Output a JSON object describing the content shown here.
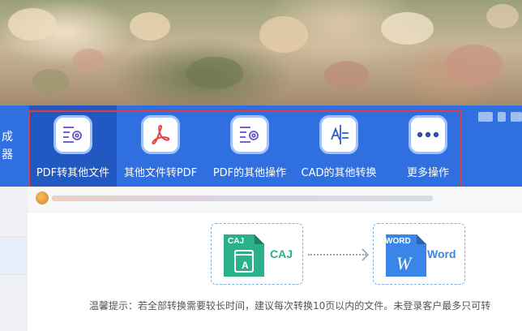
{
  "sidebar_edge": {
    "text": "成器"
  },
  "toolbar": {
    "items": [
      {
        "label": "PDF转其他文件",
        "icon": "gear-doc-icon"
      },
      {
        "label": "其他文件转PDF",
        "icon": "pdf-acrobat-icon"
      },
      {
        "label": "PDF的其他操作",
        "icon": "gear-doc-icon"
      },
      {
        "label": "CAD的其他转换",
        "icon": "cad-icon"
      },
      {
        "label": "更多操作",
        "icon": "more-dots-icon"
      }
    ]
  },
  "conversion": {
    "source": {
      "tag": "CAJ",
      "name": "CAJ",
      "letter": "A",
      "color": "#2bb08c"
    },
    "target": {
      "tag": "WORD",
      "name": "Word",
      "letter": "W",
      "color": "#3a86e8"
    }
  },
  "tip": "温馨提示：若全部转换需要较长时间，建议每次转换10页以内的文件。未登录客户最多只可转",
  "colors": {
    "toolbar": "#2f6fe0",
    "active": "#2258c2",
    "frame": "#e23b3b",
    "icon_purple": "#6a4fc8",
    "icon_red": "#e24848",
    "icon_blue": "#2f5fcf"
  }
}
